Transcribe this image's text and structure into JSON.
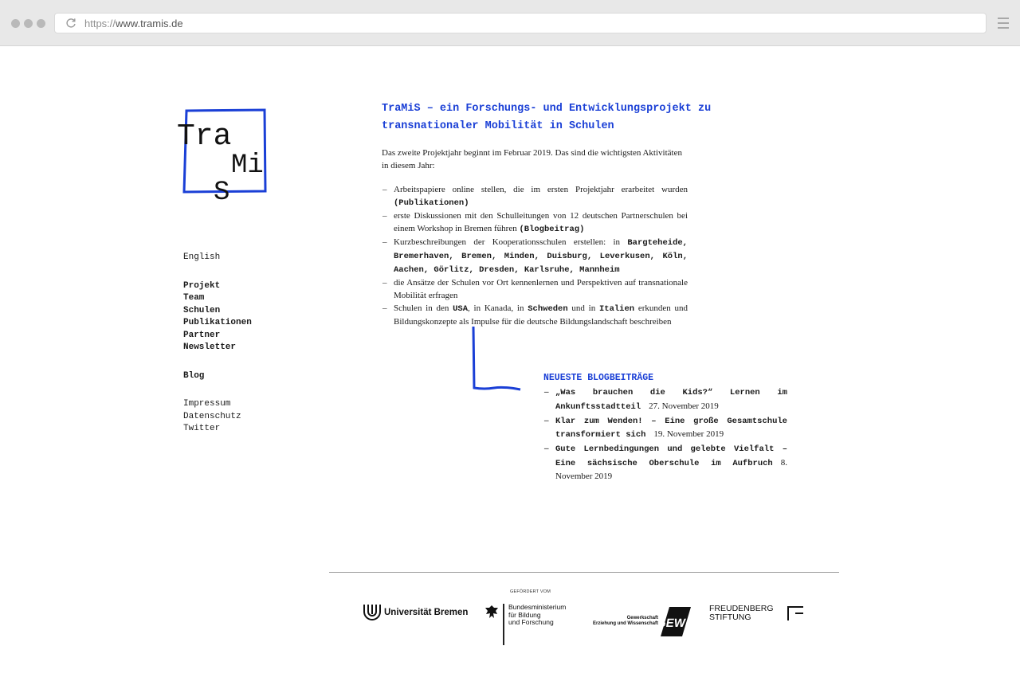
{
  "browser": {
    "url_protocol": "https://",
    "url_host": "www.tramis.de"
  },
  "logo": {
    "letters": [
      "Tra",
      "Mi",
      "S"
    ],
    "color": "#1a3fd6"
  },
  "nav": {
    "language": "English",
    "main_items": [
      "Projekt",
      "Team",
      "Schulen",
      "Publikationen",
      "Partner",
      "Newsletter"
    ],
    "blog": "Blog",
    "footer_items": [
      "Impressum",
      "Datenschutz",
      "Twitter"
    ]
  },
  "main": {
    "title": "TraMiS – ein Forschungs- und Entwicklungsprojekt zu transnationaler Mobilität in Schulen",
    "intro": "Das zweite Projektjahr beginnt im Februar 2019. Das sind die wichtigsten Aktivitäten in diesem Jahr:",
    "items": [
      {
        "text": "Arbeitspapiere online stellen, die im ersten Projektjahr erarbeitet wurden ",
        "link": "(Publikationen)"
      },
      {
        "text": "erste Diskussionen mit den Schulleitungen von 12 deutschen Partnerschulen bei einem Workshop in Bremen führen ",
        "link": "(Blogbeitrag)"
      },
      {
        "text": "Kurzbeschreibungen der Kooperationsschulen erstellen: in ",
        "link": "Bargteheide, Bremerhaven, Bremen, Minden, Duisburg, Leverkusen, Köln, Aachen, Görlitz, Dresden, Karlsruhe, Mannheim"
      },
      {
        "text": "die Ansätze der Schulen vor Ort kennenlernen und Perspektiven auf transnationale Mobilität erfragen",
        "link": ""
      },
      {
        "text": "Schulen in den ",
        "link": "USA",
        "text2": ", in Kanada, in ",
        "link2": "Schweden",
        "text3": " und in ",
        "link3": "Italien",
        "text4": " erkunden und Bildungskonzepte als Impulse für die deutsche Bildungslandschaft beschreiben"
      }
    ]
  },
  "blog": {
    "heading": "NEUESTE BLOGBEITRÄGE",
    "posts": [
      {
        "title": "„Was brauchen die Kids?“ Lernen im Ankunftsstadtteil",
        "date": "27. November 2019"
      },
      {
        "title": "Klar zum Wenden! – Eine große Gesamtschule transformiert sich",
        "date": "19. November 2019"
      },
      {
        "title": "Gute Lernbedingungen und gelebte Vielfalt – Eine sächsische Oberschule im Aufbruch",
        "date": "8. November 2019"
      }
    ]
  },
  "footer": {
    "funded_label": "GEFÖRDERT VOM",
    "uni": "Universität Bremen",
    "bmbf": [
      "Bundesministerium",
      "für Bildung",
      "und Forschung"
    ],
    "gew_text": [
      "Gewerkschaft",
      "Erziehung und Wissenschaft"
    ],
    "gew_logo": "GEW",
    "freudenberg": [
      "FREUDENBERG",
      "STIFTUNG"
    ]
  },
  "colors": {
    "accent": "#1a3fd6"
  }
}
